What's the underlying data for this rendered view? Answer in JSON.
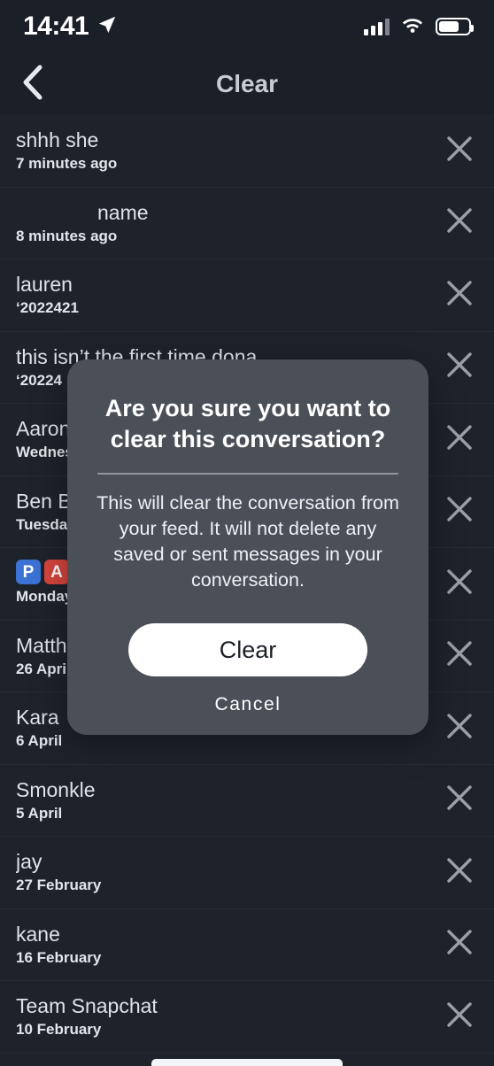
{
  "status_bar": {
    "time": "14:41",
    "location_icon": "location-arrow-icon",
    "signal_icon": "cellular-signal-icon",
    "wifi_icon": "wifi-icon",
    "battery_icon": "battery-icon",
    "battery_level_percent": 70
  },
  "header": {
    "back_icon": "chevron-left-icon",
    "title": "Clear"
  },
  "colors": {
    "background": "#1e222b",
    "header_background": "#1b1f27",
    "dialog_background": "#4b4f58",
    "primary_text": "#dfe3e8",
    "button_background": "#ffffff",
    "button_text": "#1b1f27",
    "badge_blue": "#3b72d4",
    "badge_red": "#d6453e",
    "close_icon": "#9aa0a8"
  },
  "list": {
    "close_icon": "close-icon",
    "rows": [
      {
        "name": "shhh she",
        "sub": "7 minutes ago",
        "indented": false,
        "badges": []
      },
      {
        "name": "name",
        "sub": "8 minutes ago",
        "indented": true,
        "badges": []
      },
      {
        "name": "lauren",
        "sub": "‘2022421",
        "indented": false,
        "badges": []
      },
      {
        "name": "this isn’t the first time dona",
        "sub": "‘20224",
        "indented": false,
        "badges": []
      },
      {
        "name": "Aaron",
        "sub": "Wednesday",
        "indented": false,
        "badges": []
      },
      {
        "name": "Ben B",
        "sub": "Tuesday",
        "indented": false,
        "badges": []
      },
      {
        "name": "",
        "sub": "Monday",
        "indented": false,
        "badges": [
          {
            "letter": "P",
            "color": "#3b72d4"
          },
          {
            "letter": "A",
            "color": "#d6453e"
          }
        ]
      },
      {
        "name": "Matthew",
        "sub": "26 April",
        "indented": false,
        "badges": []
      },
      {
        "name": "Kara",
        "sub": "6 April",
        "indented": false,
        "badges": []
      },
      {
        "name": "Smonkle",
        "sub": "5 April",
        "indented": false,
        "badges": []
      },
      {
        "name": "jay",
        "sub": "27 February",
        "indented": false,
        "badges": []
      },
      {
        "name": "kane",
        "sub": "16 February",
        "indented": false,
        "badges": []
      },
      {
        "name": "Team Snapchat",
        "sub": "10 February",
        "indented": false,
        "badges": []
      }
    ]
  },
  "dialog": {
    "title": "Are you sure you want to clear this conversation?",
    "body": "This will clear the conversation from your feed. It will not delete any saved or sent messages in your conversation.",
    "confirm_label": "Clear",
    "cancel_label": "Cancel"
  }
}
